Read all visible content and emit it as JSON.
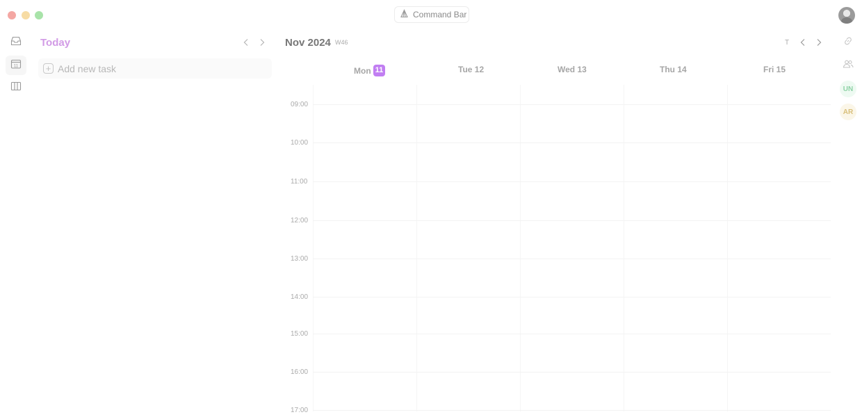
{
  "window": {
    "controls": [
      "close",
      "minimize",
      "zoom"
    ]
  },
  "command_bar": {
    "label": "Command Bar",
    "icon": "command-icon"
  },
  "profile": {
    "icon": "avatar"
  },
  "left_rail": {
    "items": [
      {
        "name": "inbox",
        "icon": "inbox-icon"
      },
      {
        "name": "calendar",
        "icon": "calendar-icon",
        "active": true
      },
      {
        "name": "board",
        "icon": "columns-icon"
      }
    ]
  },
  "today_panel": {
    "title": "Today",
    "add_task": {
      "placeholder": "Add new task"
    }
  },
  "calendar": {
    "month_label": "Nov 2024",
    "week_label": "W46",
    "today_button": "T",
    "days": [
      {
        "name": "Mon",
        "date": "11",
        "today": true
      },
      {
        "name": "Tue 12"
      },
      {
        "name": "Wed 13"
      },
      {
        "name": "Thu 14"
      },
      {
        "name": "Fri 15"
      }
    ],
    "hours": [
      "09:00",
      "10:00",
      "11:00",
      "12:00",
      "13:00",
      "14:00",
      "15:00",
      "16:00",
      "17:00"
    ]
  },
  "right_rail": {
    "icons": [
      "link-icon",
      "people-icon"
    ],
    "chips": [
      "UN",
      "AR"
    ]
  },
  "colors": {
    "accent": "#c17ef2",
    "today_title": "#d29be6"
  }
}
